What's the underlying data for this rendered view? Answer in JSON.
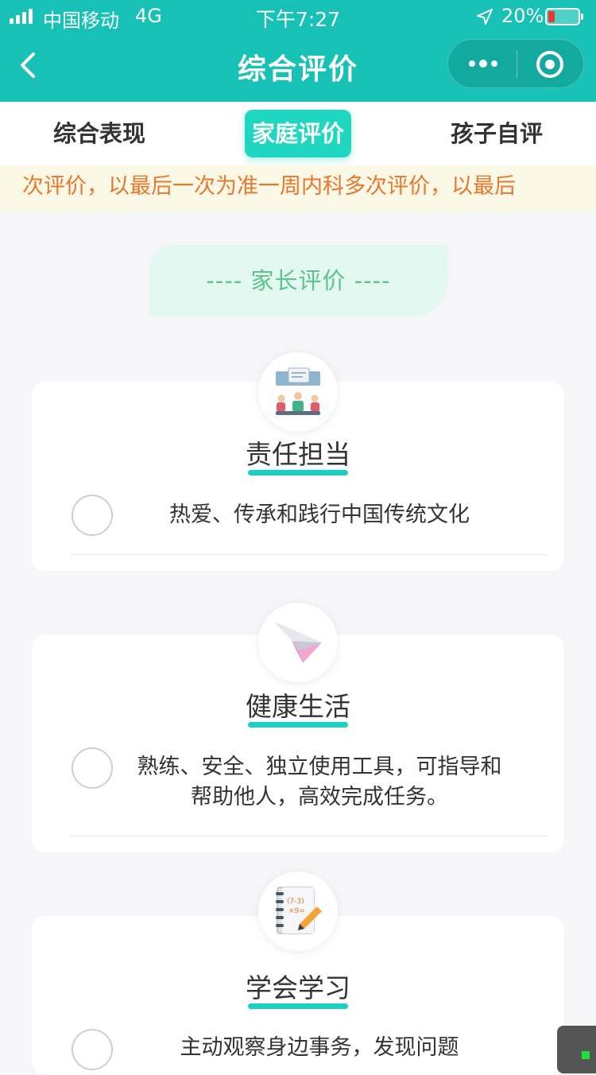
{
  "status_bar": {
    "carrier": "中国移动",
    "network": "4G",
    "time": "下午7:27",
    "battery_percent": "20%",
    "battery_level": 0.2
  },
  "nav": {
    "title": "综合评价"
  },
  "tabs": [
    {
      "label": "综合表现"
    },
    {
      "label": "家庭评价",
      "active": true
    },
    {
      "label": "孩子自评"
    }
  ],
  "marquee": {
    "text": "次评价，以最后一次为准一周内科多次评价，以最后"
  },
  "section": {
    "title": "---- 家长评价 ----"
  },
  "categories": [
    {
      "name": "责任担当",
      "icon": "meeting-icon",
      "item": "热爱、传承和践行中国传统文化"
    },
    {
      "name": "健康生活",
      "icon": "paper-plane-icon",
      "item_lines": [
        "熟练、安全、独立使用工具，可指导和",
        "帮助他人，高效完成任务。"
      ]
    },
    {
      "name": "学会学习",
      "icon": "notebook-icon",
      "item": "主动观察身边事务，发现问题"
    }
  ],
  "colors": {
    "brand": "#17c1b6",
    "tab_active": "#1fd6c0",
    "marquee_text": "#e8772e",
    "section_text": "#5cc48c",
    "underline": "#19d0c2"
  }
}
